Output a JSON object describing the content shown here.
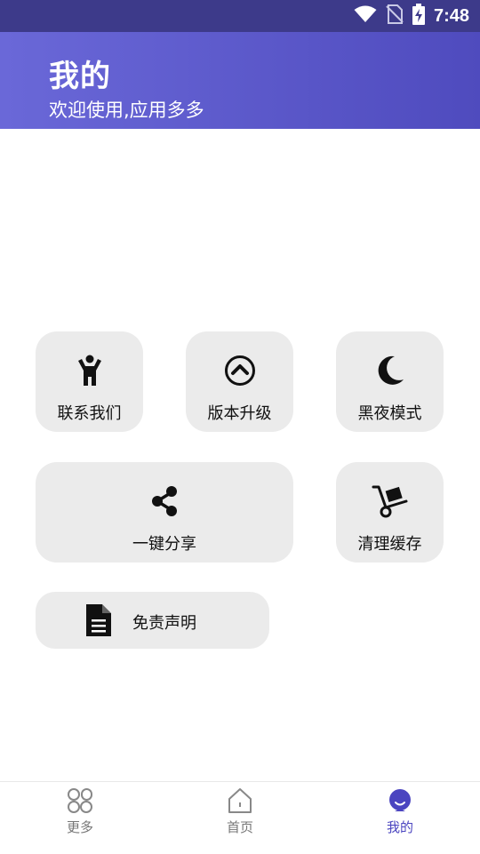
{
  "status_bar": {
    "time": "7:48"
  },
  "header": {
    "title": "我的",
    "subtitle": "欢迎使用,应用多多"
  },
  "tiles": {
    "contact": {
      "label": "联系我们",
      "icon": "person-icon"
    },
    "upgrade": {
      "label": "版本升级",
      "icon": "chevron-up-circle-icon"
    },
    "night": {
      "label": "黑夜模式",
      "icon": "moon-icon"
    },
    "share": {
      "label": "一键分享",
      "icon": "share-icon"
    },
    "clear": {
      "label": "清理缓存",
      "icon": "hand-truck-icon"
    },
    "disclaimer": {
      "label": "免责声明",
      "icon": "document-icon"
    }
  },
  "bottom_nav": {
    "items": [
      {
        "label": "更多",
        "icon": "grid-icon",
        "active": false
      },
      {
        "label": "首页",
        "icon": "home-icon",
        "active": false
      },
      {
        "label": "我的",
        "icon": "profile-icon",
        "active": true
      }
    ],
    "active_color": "#4b45c0"
  },
  "colors": {
    "header_start": "#6a68d8",
    "header_end": "#4f4bbe",
    "tile_bg": "#ebebeb"
  }
}
